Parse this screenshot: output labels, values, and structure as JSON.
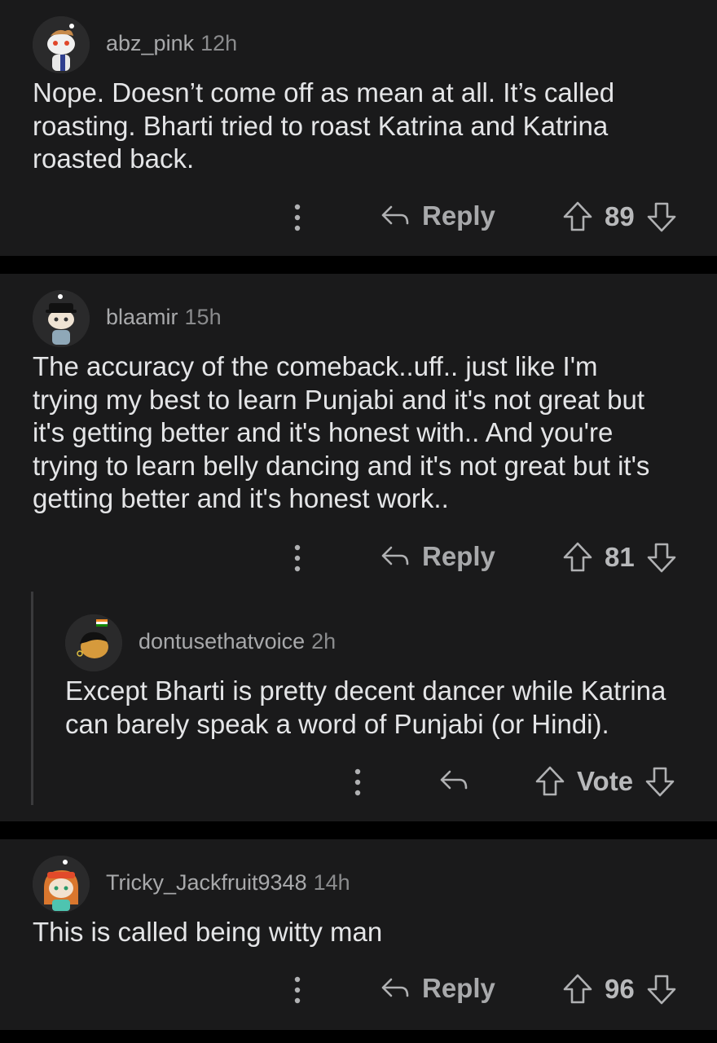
{
  "comments": [
    {
      "user": "abz_pink",
      "time": "12h",
      "text": "Nope. Doesn’t come off as mean at all. It’s called\nroasting. Bharti tried to roast Katrina and Katrina\nroasted back.",
      "reply_label": "Reply",
      "votes": "89"
    },
    {
      "user": "blaamir",
      "time": "15h",
      "text": "The accuracy of the comeback..uff.. just like I'm\ntrying my best to learn Punjabi and it's not great but\nit's getting better and it's honest with.. And you're\ntrying to learn belly dancing and it's not great but it's\ngetting better and it's honest work..",
      "reply_label": "Reply",
      "votes": "81",
      "replies": [
        {
          "user": "dontusethatvoice",
          "time": "2h",
          "text": "Except Bharti is pretty decent dancer while Katrina\ncan barely speak a word of Punjabi (or Hindi).",
          "votes": "Vote"
        }
      ]
    },
    {
      "user": "Tricky_Jackfruit9348",
      "time": "14h",
      "text": "This is called being witty man",
      "reply_label": "Reply",
      "votes": "96"
    }
  ],
  "icons": {
    "more": "more-vertical-icon",
    "reply": "reply-arrow-icon",
    "upvote": "upvote-arrow-icon",
    "downvote": "downvote-arrow-icon"
  },
  "colors": {
    "background": "#000000",
    "card": "#1a1a1b",
    "text": "#e4e5e7",
    "muted": "#9a9b9d"
  }
}
